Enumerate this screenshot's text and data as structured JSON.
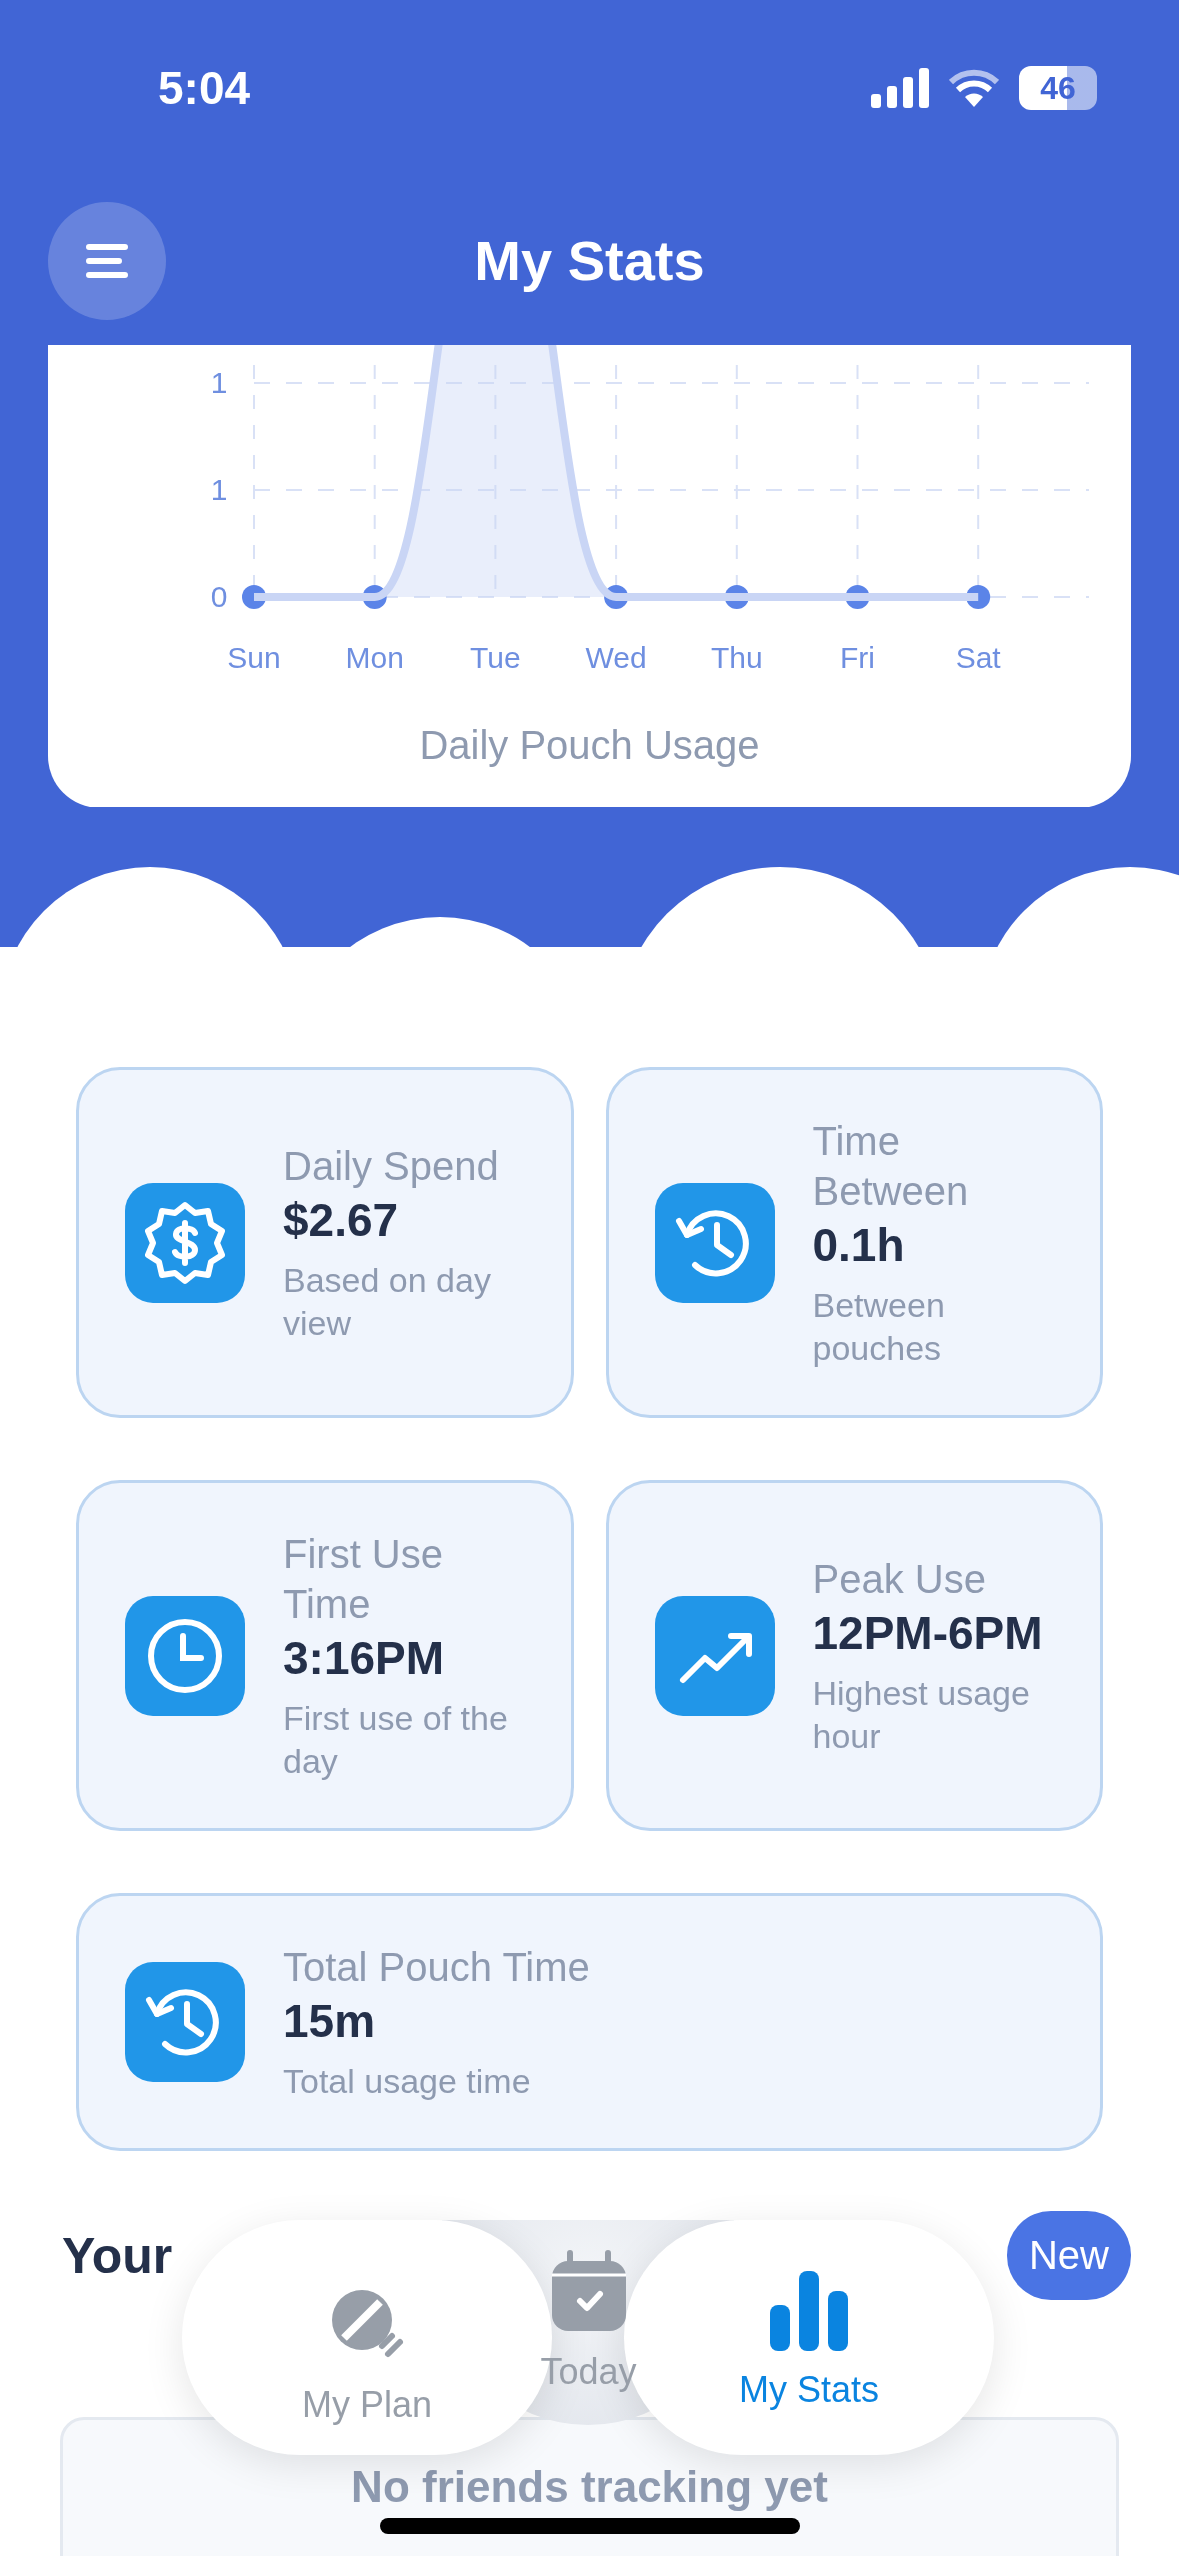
{
  "status_bar": {
    "time": "5:04",
    "battery": "46"
  },
  "header": {
    "title": "My Stats"
  },
  "chart": {
    "chart_data": {
      "type": "area",
      "title": "Daily Pouch Usage",
      "categories": [
        "Sun",
        "Mon",
        "Tue",
        "Wed",
        "Thu",
        "Fri",
        "Sat"
      ],
      "series": [
        {
          "color": "#c9d5f5",
          "values": [
            0,
            0,
            null,
            0,
            0,
            0,
            0
          ]
        }
      ],
      "ylim": [
        0,
        1
      ],
      "grid": true,
      "yticks": [
        {
          "value": 0,
          "label": "0"
        },
        {
          "value": 0.5,
          "label": "1"
        },
        {
          "value": 1,
          "label": "1"
        }
      ]
    }
  },
  "stats": [
    {
      "kind": "dollar-badge",
      "label": "Daily Spend",
      "value": "$2.67",
      "note": "Based on day view"
    },
    {
      "kind": "history",
      "label": "Time Between",
      "value": "0.1h",
      "note": "Between pouches"
    },
    {
      "kind": "clock",
      "label": "First Use Time",
      "value": "3:16PM",
      "note": "First use of the day"
    },
    {
      "kind": "trend",
      "label": "Peak Use",
      "value": "12PM-6PM",
      "note": "Highest usage hour"
    },
    {
      "kind": "history",
      "label": "Total Pouch Time",
      "value": "15m",
      "note": "Total usage time",
      "wide": true
    }
  ],
  "friends": {
    "heading": "Your",
    "new_button": "New",
    "empty_message": "No friends tracking yet"
  },
  "tab_bar": [
    {
      "kind": "plan",
      "label": "My Plan",
      "selected": false
    },
    {
      "kind": "today",
      "label": "Today",
      "selected": false
    },
    {
      "kind": "stats",
      "label": "My Stats",
      "selected": true
    }
  ]
}
